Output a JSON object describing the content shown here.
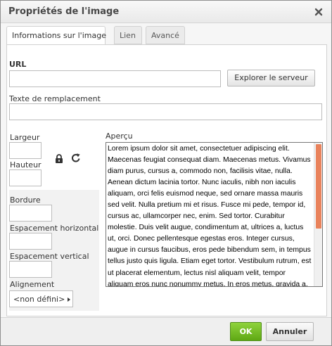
{
  "dialog": {
    "title": "Propriétés de l'image"
  },
  "tabs": [
    {
      "label": "Informations sur l'image",
      "active": true
    },
    {
      "label": "Lien",
      "active": false
    },
    {
      "label": "Avancé",
      "active": false
    }
  ],
  "form": {
    "url_label": "URL",
    "url_value": "",
    "browse_server_label": "Explorer le serveur",
    "alt_text_label": "Texte de remplacement",
    "alt_text_value": "",
    "width_label": "Largeur",
    "width_value": "",
    "height_label": "Hauteur",
    "height_value": "",
    "border_label": "Bordure",
    "border_value": "",
    "hspace_label": "Espacement horizontal",
    "hspace_value": "",
    "vspace_label": "Espacement vertical",
    "vspace_value": "",
    "align_label": "Alignement",
    "align_value": "<non défini>"
  },
  "preview": {
    "label": "Aperçu",
    "text": "Lorem ipsum dolor sit amet, consectetuer adipiscing elit. Maecenas feugiat consequat diam. Maecenas metus. Vivamus diam purus, cursus a, commodo non, facilisis vitae, nulla. Aenean dictum lacinia tortor. Nunc iaculis, nibh non iaculis aliquam, orci felis euismod neque, sed ornare massa mauris sed velit. Nulla pretium mi et risus. Fusce mi pede, tempor id, cursus ac, ullamcorper nec, enim. Sed tortor. Curabitur molestie. Duis velit augue, condimentum at, ultrices a, luctus ut, orci. Donec pellentesque egestas eros. Integer cursus, augue in cursus faucibus, eros pede bibendum sem, in tempus tellus justo quis ligula. Etiam eget tortor. Vestibulum rutrum, est ut placerat elementum, lectus nisl aliquam velit, tempor aliquam eros nunc nonummy metus. In eros metus, gravida a, gravida sed, lobortis id, turpis."
  },
  "footer": {
    "ok_label": "OK",
    "cancel_label": "Annuler"
  },
  "colors": {
    "ok_button": "#6ab21f",
    "scroll_thumb": "#e9825b"
  },
  "icons": {
    "close": "close-icon",
    "lock": "lock-icon",
    "reset": "reset-size-icon"
  }
}
